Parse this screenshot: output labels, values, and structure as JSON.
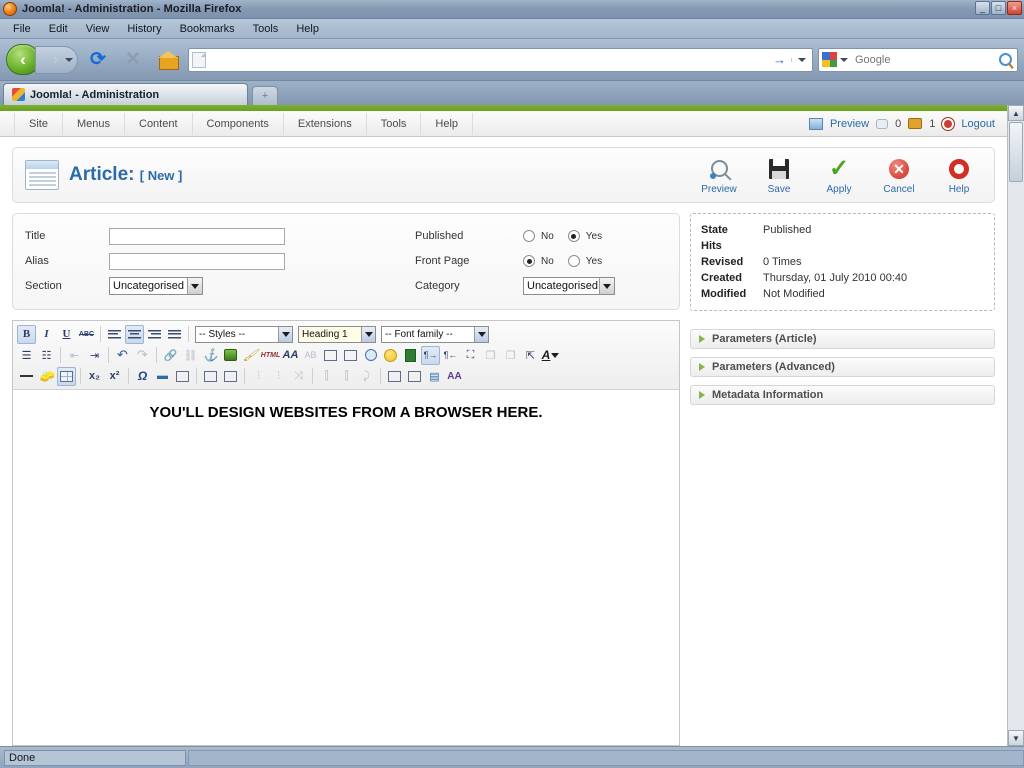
{
  "window": {
    "title": "Joomla! - Administration - Mozilla Firefox",
    "minimize": "_",
    "maximize": "□",
    "close": "×"
  },
  "menubar": {
    "items": [
      "File",
      "Edit",
      "View",
      "History",
      "Bookmarks",
      "Tools",
      "Help"
    ]
  },
  "navbar": {
    "back_label": "‹",
    "forward_label": "›",
    "reload_label": "⟳",
    "stop_label": "✕",
    "home_label": "home",
    "url_value": "",
    "url_placeholder": "",
    "go_label": "→",
    "search_value": "",
    "search_placeholder": "Google",
    "search_engine": "Google"
  },
  "tabbar": {
    "tabs": [
      {
        "label": "Joomla! - Administration"
      }
    ],
    "new_tab_label": "+"
  },
  "joomla": {
    "menu": [
      "Site",
      "Menus",
      "Content",
      "Components",
      "Extensions",
      "Tools",
      "Help"
    ],
    "preview_label": "Preview",
    "messages_count": "0",
    "users_count": "1",
    "logout_label": "Logout",
    "page_title": "Article:",
    "page_title_sub": "[ New ]",
    "toolbar": [
      {
        "label": "Preview",
        "icon": "magnifier-icon"
      },
      {
        "label": "Save",
        "icon": "floppy-disk-icon"
      },
      {
        "label": "Apply",
        "icon": "checkmark-icon"
      },
      {
        "label": "Cancel",
        "icon": "cancel-circle-icon"
      },
      {
        "label": "Help",
        "icon": "lifering-icon"
      }
    ],
    "fields": {
      "title_label": "Title",
      "title_value": "",
      "alias_label": "Alias",
      "alias_value": "",
      "section_label": "Section",
      "section_value": "Uncategorised",
      "published_label": "Published",
      "published_no": "No",
      "published_yes": "Yes",
      "published_selected": "Yes",
      "frontpage_label": "Front Page",
      "frontpage_no": "No",
      "frontpage_yes": "Yes",
      "frontpage_selected": "No",
      "category_label": "Category",
      "category_value": "Uncategorised"
    },
    "info": [
      {
        "key": "State",
        "value": "Published"
      },
      {
        "key": "Hits",
        "value": ""
      },
      {
        "key": "Revised",
        "value": "0 Times"
      },
      {
        "key": "Created",
        "value": "Thursday, 01 July 2010 00:40"
      },
      {
        "key": "Modified",
        "value": "Not Modified"
      }
    ],
    "accordions": [
      "Parameters (Article)",
      "Parameters (Advanced)",
      "Metadata Information"
    ]
  },
  "editor": {
    "styles_value": "-- Styles --",
    "format_value": "Heading 1",
    "fontfamily_value": "-- Font family --",
    "bold_label": "B",
    "italic_label": "I",
    "underline_label": "U",
    "strike_label": "ABC",
    "content_heading": "YOU'LL DESIGN WEBSITES FROM A BROWSER HERE."
  },
  "statusbar": {
    "text": "Done"
  }
}
